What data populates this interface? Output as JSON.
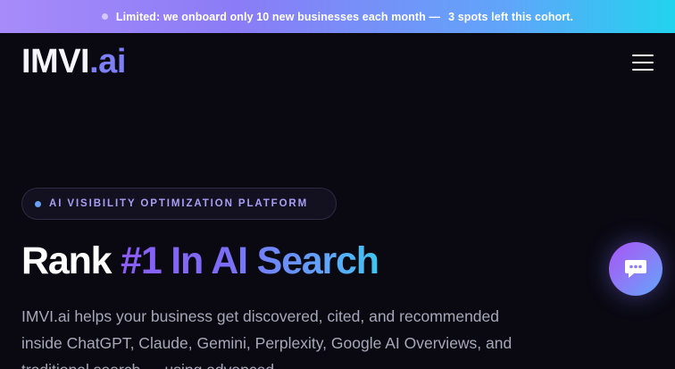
{
  "banner": {
    "text": "Limited: we onboard only 10 new businesses each month —",
    "cta": "3 spots left this cohort."
  },
  "header": {
    "logo_main": "IMVI",
    "logo_suffix": ".ai",
    "menu_icon": "hamburger-menu-icon"
  },
  "hero": {
    "badge": "AI VISIBILITY OPTIMIZATION PLATFORM",
    "headline_plain": "Rank",
    "headline_accent": "#1 In AI Search",
    "description": "IMVI.ai helps your business get discovered, cited, and recommended inside ChatGPT, Claude, Gemini, Perplexity, Google AI Overviews, and traditional search — using advanced"
  },
  "chat": {
    "icon": "chat-bubble-icon"
  },
  "colors": {
    "background": "#0a0912",
    "accent_purple": "#8b5cf6",
    "accent_blue": "#60a5fa",
    "accent_cyan": "#22d3ee",
    "badge_text": "#a99ef5",
    "body_text": "#a8a7b8"
  }
}
